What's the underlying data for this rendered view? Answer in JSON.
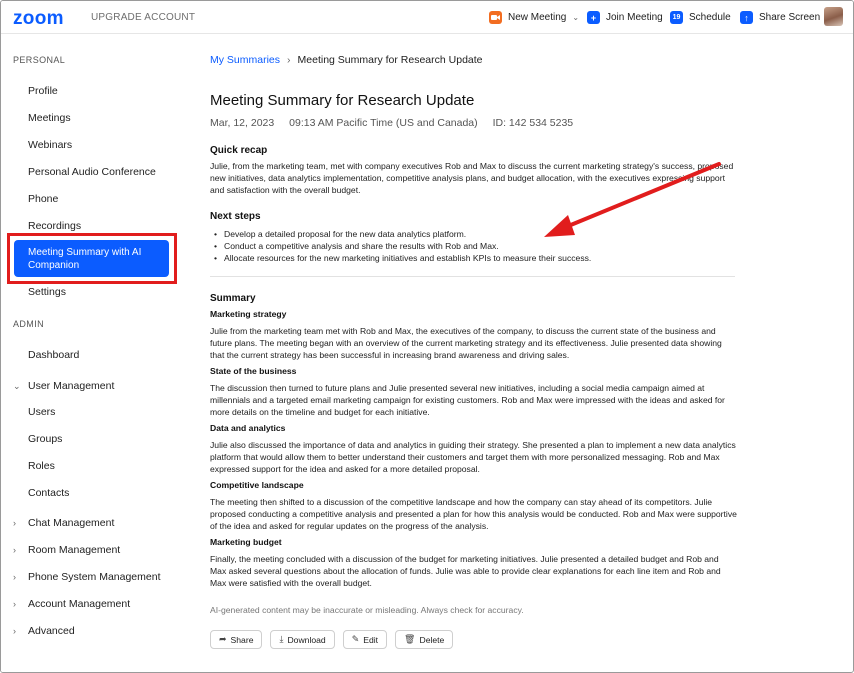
{
  "app": {
    "logo": "zoom",
    "upgrade": "UPGRADE ACCOUNT"
  },
  "topnav": {
    "new_meeting": "New Meeting",
    "join_meeting": "Join Meeting",
    "schedule": "Schedule",
    "schedule_day": "19",
    "share_screen": "Share Screen",
    "colors": {
      "new_meeting": "#f26d21",
      "blue": "#0b5cff"
    }
  },
  "sidebar": {
    "personal_label": "PERSONAL",
    "personal_items": [
      "Profile",
      "Meetings",
      "Webinars",
      "Personal Audio Conference",
      "Phone",
      "Recordings"
    ],
    "active_item": "Meeting Summary with AI Companion",
    "settings": "Settings",
    "admin_label": "ADMIN",
    "dashboard": "Dashboard",
    "user_management": "User Management",
    "user_sub": [
      "Users",
      "Groups",
      "Roles",
      "Contacts"
    ],
    "groups": [
      "Chat Management",
      "Room Management",
      "Phone System Management",
      "Account Management",
      "Advanced"
    ]
  },
  "breadcrumb": {
    "root": "My Summaries",
    "current": "Meeting Summary for Research Update"
  },
  "summary": {
    "title": "Meeting Summary for Research Update",
    "date": "Mar, 12, 2023",
    "time": "09:13 AM Pacific Time (US and Canada)",
    "meeting_id": "ID: 142 534 5235",
    "quick_recap_heading": "Quick recap",
    "quick_recap": "Julie, from the marketing team, met with company executives Rob and Max to discuss the current marketing strategy's success, proposed new initiatives, data analytics implementation, competitive analysis plans, and budget allocation, with the executives expressing support and satisfaction with the overall budget.",
    "next_steps_heading": "Next steps",
    "next_steps": [
      "Develop a detailed proposal for the new data analytics platform.",
      "Conduct a competitive analysis and share the results with Rob and Max.",
      "Allocate resources for the new marketing initiatives and establish KPIs to measure their success."
    ],
    "summary_heading": "Summary",
    "sections": [
      {
        "heading": "Marketing strategy",
        "text": "Julie from the marketing team met with Rob and Max, the executives of the company, to discuss the current state of the business and future plans. The meeting began with an overview of the current marketing strategy and its effectiveness. Julie presented data showing that the current strategy has been successful in increasing brand awareness and driving sales."
      },
      {
        "heading": "State of the business",
        "text": "The discussion then turned to future plans and Julie presented several new initiatives, including a social media campaign aimed at millennials and a targeted email marketing campaign for existing customers. Rob and Max were impressed with the ideas and asked for more details on the timeline and budget for each initiative."
      },
      {
        "heading": "Data and analytics",
        "text": "Julie also discussed the importance of data and analytics in guiding their strategy. She presented a plan to implement a new data analytics platform that would allow them to better understand their customers and target them with more personalized messaging. Rob and Max expressed support for the idea and asked for a more detailed proposal."
      },
      {
        "heading": "Competitive landscape",
        "text": "The meeting then shifted to a discussion of the competitive landscape and how the company can stay ahead of its competitors. Julie proposed conducting a competitive analysis and presented a plan for how this analysis would be conducted. Rob and Max were supportive of the idea and asked for regular updates on the progress of the analysis."
      },
      {
        "heading": "Marketing budget",
        "text": "Finally, the meeting concluded with a discussion of the budget for marketing initiatives. Julie presented a detailed budget and Rob and Max asked several questions about the allocation of funds. Julie was able to provide clear explanations for each line item and Rob and Max were satisfied with the overall budget."
      }
    ],
    "disclaimer": "AI-generated content may be inaccurate or misleading. Always check for accuracy."
  },
  "actions": {
    "share": "Share",
    "download": "Download",
    "edit": "Edit",
    "delete": "Delete"
  },
  "annotation": {
    "highlight_color": "#e11d1d"
  }
}
